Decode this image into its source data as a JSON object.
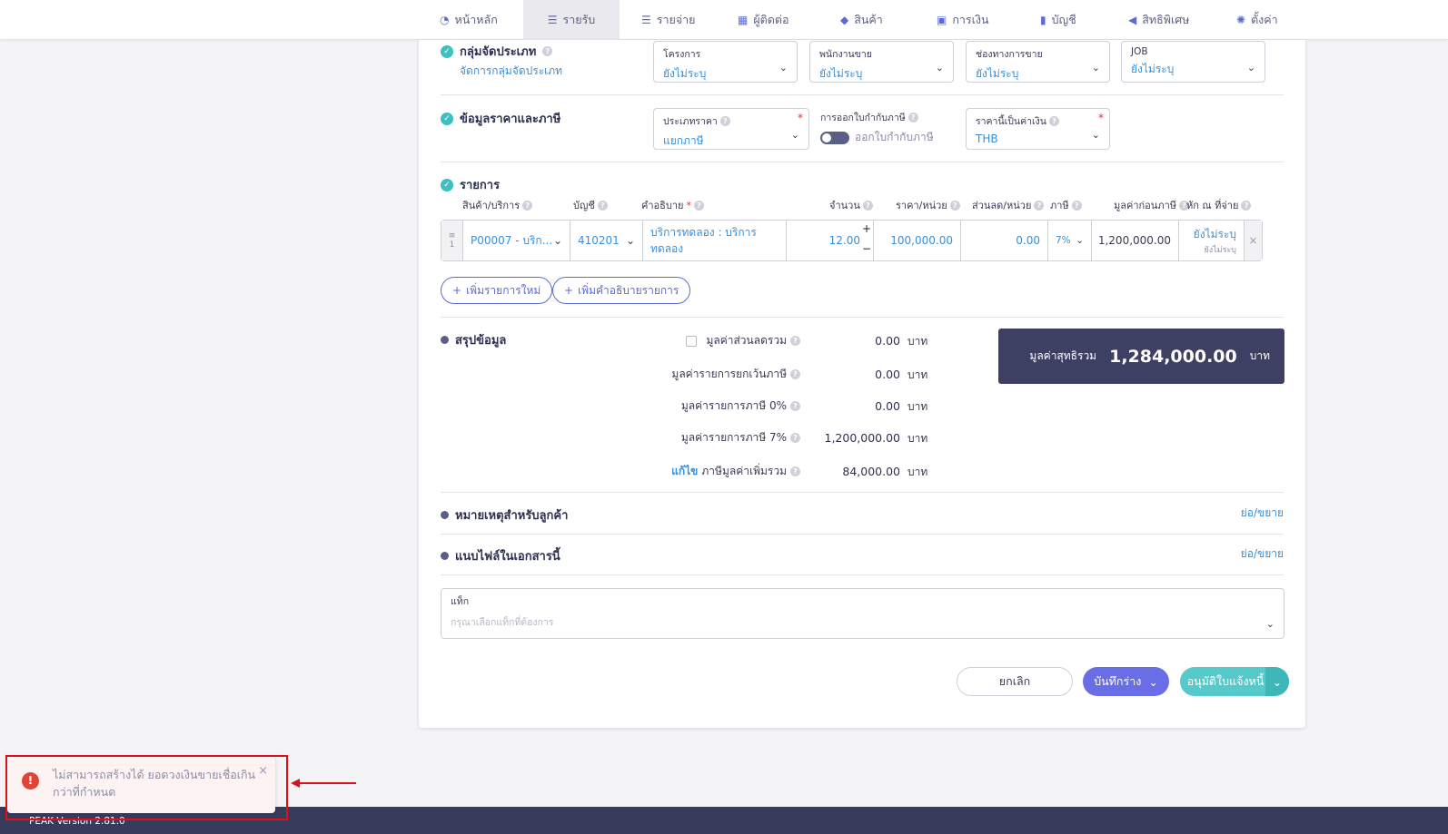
{
  "nav": {
    "items": [
      {
        "label": "หน้าหลัก",
        "icon": "dashboard-icon"
      },
      {
        "label": "รายรับ",
        "icon": "income-icon"
      },
      {
        "label": "รายจ่าย",
        "icon": "expense-icon"
      },
      {
        "label": "ผู้ติดต่อ",
        "icon": "contacts-icon"
      },
      {
        "label": "สินค้า",
        "icon": "product-icon"
      },
      {
        "label": "การเงิน",
        "icon": "finance-icon"
      },
      {
        "label": "บัญชี",
        "icon": "account-icon"
      },
      {
        "label": "สิทธิพิเศษ",
        "icon": "privilege-icon"
      },
      {
        "label": "ตั้งค่า",
        "icon": "settings-icon"
      }
    ]
  },
  "group": {
    "title": "กลุ่มจัดประเภท",
    "manage_link": "จัดการกลุ่มจัดประเภท",
    "fields": [
      {
        "label": "โครงการ",
        "value": "ยังไม่ระบุ"
      },
      {
        "label": "พนักงานขาย",
        "value": "ยังไม่ระบุ"
      },
      {
        "label": "ช่องทางการขาย",
        "value": "ยังไม่ระบุ"
      },
      {
        "label": "JOB",
        "value": "ยังไม่ระบุ"
      }
    ]
  },
  "pricing": {
    "title": "ข้อมูลราคาและภาษี",
    "price_type_label": "ประเภทราคา",
    "price_type_value": "แยกภาษี",
    "tax_invoice_label": "การออกใบกำกับภาษี",
    "tax_invoice_toggle_label": "ออกใบกำกับภาษี",
    "currency_label": "ราคานี้เป็นค่าเงิน",
    "currency_value": "THB"
  },
  "items": {
    "title": "รายการ",
    "columns": [
      "สินค้า/บริการ",
      "บัญชี",
      "คำอธิบาย",
      "จำนวน",
      "ราคา/หน่วย",
      "ส่วนลด/หน่วย",
      "ภาษี",
      "มูลค่าก่อนภาษี",
      "หัก ณ ที่จ่าย"
    ],
    "row": {
      "index": "1",
      "product": "P00007 - บริก...",
      "account": "410201",
      "description": "บริการทดลอง : บริการทดลอง",
      "qty": "12.00",
      "price": "100,000.00",
      "discount": "0.00",
      "tax": "7%",
      "pre_tax": "1,200,000.00",
      "wht": "ยังไม่ระบุ",
      "wht_sub": "ยังไม่ระบุ"
    },
    "add_item": "เพิ่มรายการใหม่",
    "add_description": "เพิ่มคำอธิบายรายการ"
  },
  "summary": {
    "title": "สรุปข้อมูล",
    "discount_label": "มูลค่าส่วนลดรวม",
    "discount_value": "0.00",
    "exempt_label": "มูลค่ารายการยกเว้นภาษี",
    "exempt_value": "0.00",
    "zero_label": "มูลค่ารายการภาษี 0%",
    "zero_value": "0.00",
    "seven_label": "มูลค่ารายการภาษี 7%",
    "seven_value": "1,200,000.00",
    "edit_link": "แก้ไข",
    "vat_label": "ภาษีมูลค่าเพิ่มรวม",
    "vat_value": "84,000.00",
    "unit": "บาท",
    "total_label": "มูลค่าสุทธิรวม",
    "total_value": "1,284,000.00"
  },
  "notes": {
    "title": "หมายเหตุสำหรับลูกค้า",
    "toggle": "ย่อ/ขยาย"
  },
  "attachments": {
    "title": "แนบไฟล์ในเอกสารนี้",
    "toggle": "ย่อ/ขยาย"
  },
  "tags": {
    "label": "แท็ก",
    "placeholder": "กรุณาเลือกแท็กที่ต้องการ"
  },
  "actions": {
    "cancel": "ยกเลิก",
    "save_draft": "บันทึกร่าง",
    "approve": "อนุมัติใบแจ้งหนี้"
  },
  "footer": {
    "version": "PEAK Version 2.81.0"
  },
  "toast": {
    "message": "ไม่สามารถสร้างได้ ยอดวงเงินขายเชื่อเกินกว่าที่กำหนด"
  },
  "colors": {
    "primary": "#5b6bd5",
    "teal": "#3fbfbf",
    "navy": "#3d3f63",
    "link": "#3a8fd6",
    "error": "#e04434"
  }
}
